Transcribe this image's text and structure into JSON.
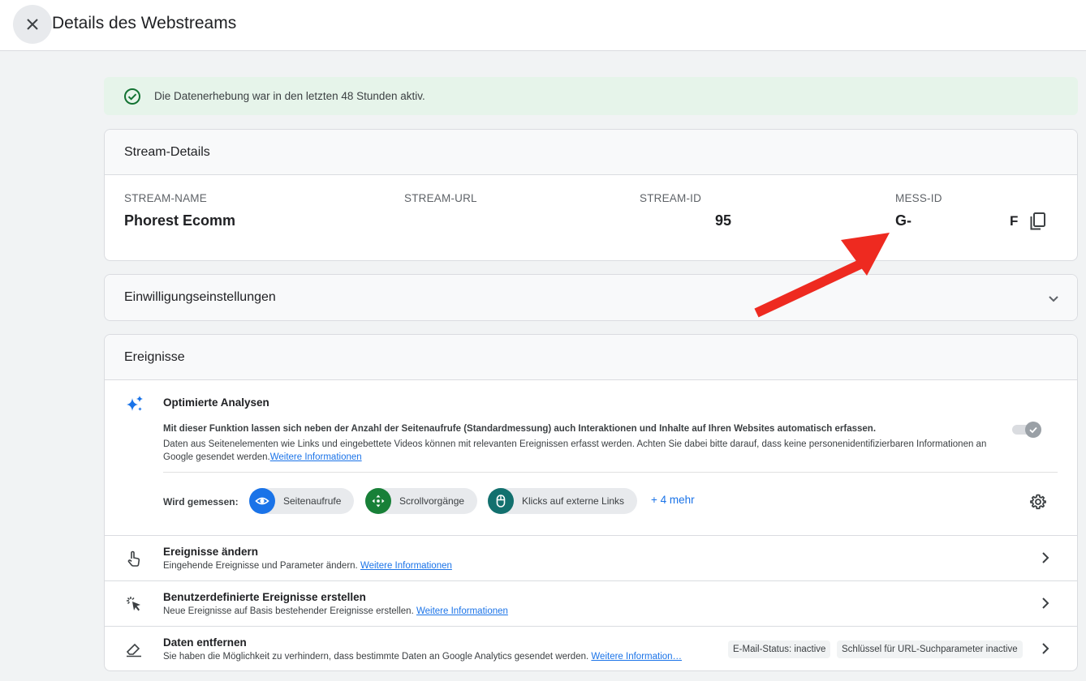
{
  "header": {
    "title": "Details des Webstreams",
    "close_icon": "close-icon"
  },
  "banner": {
    "text": "Die Datenerhebung war in den letzten 48 Stunden aktiv.",
    "icon": "check-circle-icon",
    "color": "#137333"
  },
  "stream_details": {
    "title": "Stream-Details",
    "name_label": "STREAM-NAME",
    "name_value": "Phorest Ecomm",
    "url_label": "STREAM-URL",
    "id_label": "STREAM-ID",
    "id_value": "95",
    "mess_label": "MESS-ID",
    "mess_value": "G-",
    "mess_suffix": "F"
  },
  "consent": {
    "title": "Einwilligungseinstellungen"
  },
  "events": {
    "title": "Ereignisse",
    "enhanced": {
      "title": "Optimierte Analysen",
      "desc_bold": "Mit dieser Funktion lassen sich neben der Anzahl der Seitenaufrufe (Standardmessung) auch Interaktionen und Inhalte auf Ihren Websites automatisch erfassen.",
      "desc": "Daten aus Seitenelementen wie Links und eingebettete Videos können mit relevanten Ereignissen erfasst werden. Achten Sie dabei bitte darauf, dass keine personenidentifizierbaren Informationen an Google gesendet werden.",
      "link": "Weitere Informationen",
      "measured_label": "Wird gemessen:",
      "chips": [
        {
          "label": "Seitenaufrufe",
          "icon": "eye-icon",
          "color": "#1a73e8"
        },
        {
          "label": "Scrollvorgänge",
          "icon": "scroll-icon",
          "color": "#188038"
        },
        {
          "label": "Klicks auf externe Links",
          "icon": "mouse-icon",
          "color": "#12706e"
        }
      ],
      "more": "+ 4 mehr"
    },
    "rows": [
      {
        "title": "Ereignisse ändern",
        "desc": "Eingehende Ereignisse und Parameter ändern.",
        "link": "Weitere Informationen",
        "icon": "touch-icon"
      },
      {
        "title": "Benutzerdefinierte Ereignisse erstellen",
        "desc": "Neue Ereignisse auf Basis bestehender Ereignisse erstellen.",
        "link": "Weitere Informationen",
        "icon": "cursor-click-icon"
      },
      {
        "title": "Daten entfernen",
        "desc": "Sie haben die Möglichkeit zu verhindern, dass bestimmte Daten an Google Analytics gesendet werden.",
        "link": "Weitere Information…",
        "icon": "eraser-icon",
        "badge1": "E-Mail-Status: inactive",
        "badge2": "Schlüssel für URL-Suchparameter inactive"
      }
    ]
  },
  "annotation": {
    "arrow_color": "#ee2a20"
  }
}
